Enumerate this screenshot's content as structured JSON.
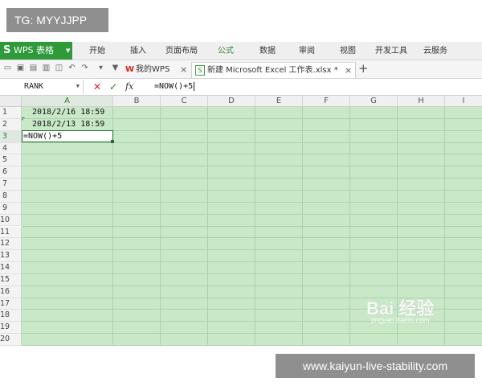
{
  "overlay": {
    "tg_label": "TG: MYYJJPP",
    "url_label": "www.kaiyun-live-stability.com"
  },
  "app": {
    "brand": "WPS 表格",
    "brand_icon": "S",
    "menu": [
      "开始",
      "插入",
      "页面布局",
      "公式",
      "数据",
      "审阅",
      "视图",
      "开发工具",
      "云服务"
    ],
    "active_menu": "公式",
    "accent_color": "#2f9a3a"
  },
  "tabs": {
    "home_tab": "我的WPS",
    "doc_tab": "新建 Microsoft Excel 工作表.xlsx *",
    "close_glyph": "×",
    "new_tab_glyph": "+"
  },
  "formula_bar": {
    "name_box": "RANK",
    "cancel_glyph": "✕",
    "confirm_glyph": "✓",
    "fx_label": "fx",
    "formula": "=NOW()+5"
  },
  "sheet": {
    "columns": [
      "A",
      "B",
      "C",
      "D",
      "E",
      "F",
      "G",
      "H",
      "I"
    ],
    "selected_column": "A",
    "rows": [
      "1",
      "2",
      "3",
      "4",
      "5",
      "6",
      "7",
      "8",
      "9",
      "10",
      "11",
      "12",
      "13",
      "14",
      "15",
      "16",
      "17",
      "18",
      "19",
      "20"
    ],
    "selected_row": "3",
    "cells": {
      "A1": "2018/2/16 18:59",
      "A2": "2018/2/13 18:59",
      "A3": "=NOW()+5"
    },
    "cell_color": "#c9e8c8"
  },
  "watermark": {
    "brand": "Bai 经验",
    "sub": "jingyan.baidu.com"
  }
}
